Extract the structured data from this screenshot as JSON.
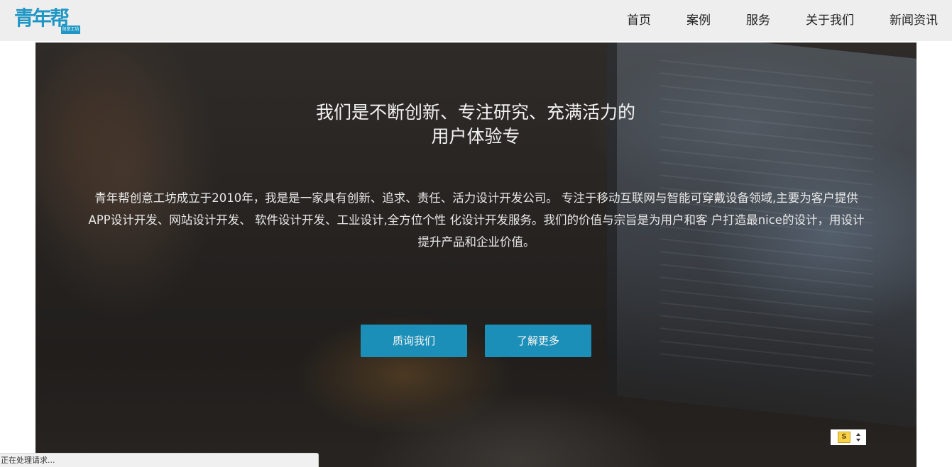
{
  "header": {
    "logo": {
      "main": "青年帮",
      "sub": "创意工坊",
      "color": "#1f97c5"
    },
    "nav": [
      {
        "label": "首页"
      },
      {
        "label": "案例"
      },
      {
        "label": "服务"
      },
      {
        "label": "关于我们"
      },
      {
        "label": "新闻资讯"
      }
    ]
  },
  "hero": {
    "title_line1": "我们是不断创新、专注研究、充满活力的",
    "title_line2": "用户体验专",
    "description": "青年帮创意工坊成立于2010年，我是是一家具有创新、追求、责任、活力设计开发公司。 专注于移动互联网与智能可穿戴设备领域,主要为客户提供APP设计开发、网站设计开发、 软件设计开发、工业设计,全方位个性 化设计开发服务。我们的价值与宗旨是为用户和客 户打造最nice的设计，用设计提升产品和企业价值。",
    "buttons": {
      "consult": "质询我们",
      "learn_more": "了解更多"
    },
    "button_color": "#1b8fb8"
  },
  "widget": {
    "icon": "s-badge-icon",
    "glyph": "S"
  },
  "status_bar": {
    "text": "正在处理请求..."
  }
}
